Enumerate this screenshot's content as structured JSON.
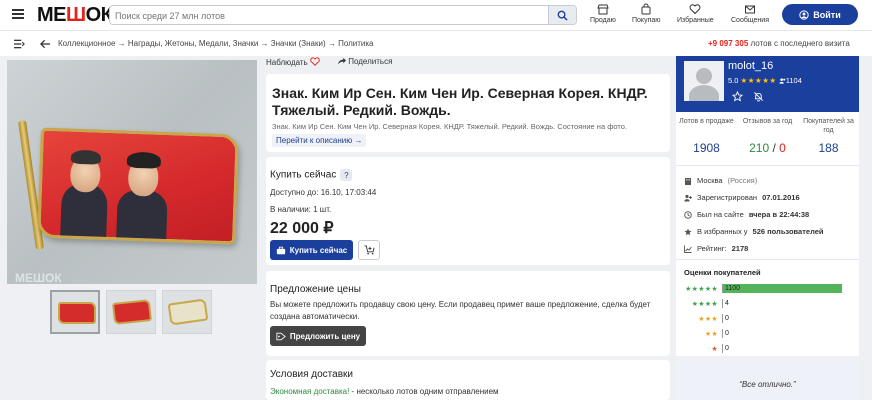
{
  "header": {
    "logo_pre": "МЕ",
    "logo_mid": "Ш",
    "logo_post": "ОК",
    "search_placeholder": "Поиск среди 27 млн лотов",
    "nav": [
      {
        "label": "Продаю",
        "icon": "store-icon"
      },
      {
        "label": "Покупаю",
        "icon": "bag-icon"
      },
      {
        "label": "Избранные",
        "icon": "heart-icon"
      },
      {
        "label": "Сообщения",
        "icon": "mail-icon"
      }
    ],
    "login_label": "Войти",
    "accent": "#1a3f9c"
  },
  "breadcrumb": {
    "path": "Коллекционное → Награды, Жетоны, Медали, Значки → Значки (Знаки) → Политика",
    "phone": "+9 097 305",
    "phone_suffix": "лотов с последнего визита"
  },
  "gallery": {
    "watermark": "МЕШОК"
  },
  "lot": {
    "watch_label": "Наблюдать",
    "share_label": "Поделиться",
    "title": "Знак. Ким Ир Сен. Ким Чен Ир. Северная Корея. КНДР. Тяжелый. Редкий. Вождь.",
    "subtitle": "Знак. Ким Ир Сен. Ким Чен Ир. Северная Корея. КНДР. Тяжелый. Редкий. Вождь. Состояние на фото.",
    "desc_link": "Перейти к описанию →"
  },
  "buy": {
    "heading": "Купить сейчас",
    "available_until": "Доступно до: 16.10, 17:03:44",
    "in_stock": "В наличии: 1 шт.",
    "price": "22 000 ₽",
    "buy_button": "Купить сейчас"
  },
  "offer": {
    "heading": "Предложение цены",
    "text": "Вы можете предложить продавцу свою цену. Если продавец примет ваше предложение, сделка будет создана автоматически.",
    "button": "Предложить цену"
  },
  "delivery": {
    "heading": "Условия доставки",
    "economy_label": "Экономная доставка!",
    "economy_text": " - несколько лотов одним отправлением"
  },
  "seller": {
    "name": "molot_16",
    "rating": "5.0",
    "stars": "★★★★★",
    "reviews": "1104",
    "stats": [
      {
        "label": "Лотов в продаже",
        "value": "1908"
      },
      {
        "label": "Отзывов за год",
        "positive": "210",
        "sep": " / ",
        "negative": "0"
      },
      {
        "label": "Покупателей за год",
        "value": "188"
      }
    ],
    "city": "Москва",
    "country": "(Россия)",
    "registered_label": "Зарегистрирован",
    "registered": "07.01.2016",
    "last_seen_label": "Был на сайте",
    "last_seen": "вчера в 22:44:38",
    "favorites_pre": "В избранных у",
    "favorites": "526 пользователей",
    "rating_label": "Рейтинг:",
    "rating_value": "2178",
    "ratings_title": "Оценки покупателей",
    "rating_rows": [
      {
        "stars": "★★★★★",
        "count": "1100",
        "fraction": 1.0
      },
      {
        "stars": "★★★★",
        "count": "4",
        "fraction": 0.0
      },
      {
        "stars": "★★★",
        "count": "0",
        "fraction": 0.0
      },
      {
        "stars": "★★",
        "count": "0",
        "fraction": 0.0
      },
      {
        "stars": "★",
        "count": "0",
        "fraction": 0.0
      }
    ],
    "review_text": "“Все отлично.”"
  }
}
